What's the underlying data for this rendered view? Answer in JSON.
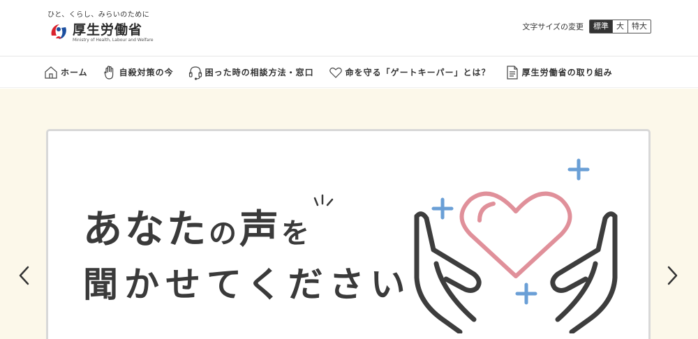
{
  "header": {
    "tagline": "ひと、くらし、みらいのために",
    "ministry_name": "厚生労働省",
    "ministry_name_en": "Ministry of Health, Labour and Welfare",
    "font_size": {
      "label": "文字サイズの変更",
      "options": [
        "標準",
        "大",
        "特大"
      ],
      "selected": "標準"
    }
  },
  "nav": {
    "items": [
      {
        "label": "ホーム",
        "icon": "home-icon"
      },
      {
        "label": "自殺対策の今",
        "icon": "hand-icon"
      },
      {
        "label": "困った時の相談方法・窓口",
        "icon": "headset-icon"
      },
      {
        "label": "命を守る「ゲートキーパー」とは？",
        "icon": "heart-icon"
      },
      {
        "label": "厚生労働省の取り組み",
        "icon": "document-icon"
      }
    ]
  },
  "hero": {
    "headline_line1_a": "あなた",
    "headline_line1_b": "の",
    "headline_line1_c": "声",
    "headline_line1_d": "を",
    "headline_line2": "聞かせてください",
    "illustration": "hands-holding-heart-icon"
  },
  "carousel": {
    "prev_icon": "chevron-left-icon",
    "next_icon": "chevron-right-icon"
  },
  "colors": {
    "heart": "#e0909a",
    "sparkle": "#6a9fd6",
    "hero_bg": "#fcf8ea",
    "text_dark": "#3a3a3a"
  }
}
